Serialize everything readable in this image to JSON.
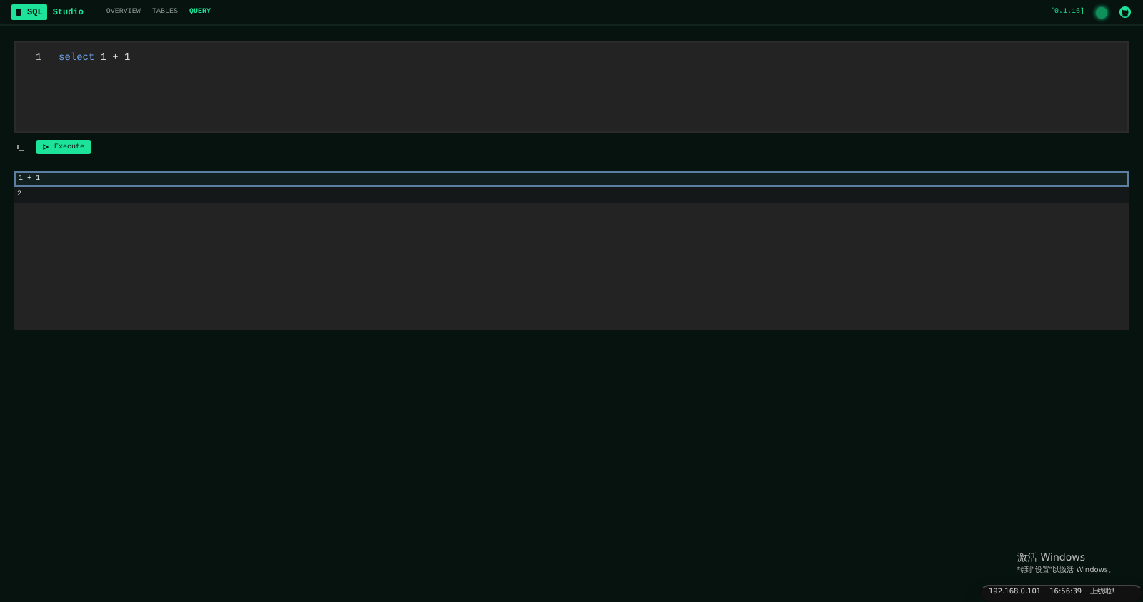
{
  "brand": {
    "part1": "SQL",
    "part2": "Studio"
  },
  "nav": [
    {
      "label": "OVERVIEW",
      "selected": false
    },
    {
      "label": "TABLES",
      "selected": false
    },
    {
      "label": "QUERY",
      "selected": true
    }
  ],
  "version": "[0.1.16]",
  "editor": {
    "lines": [
      {
        "number": "1",
        "keyword": "select",
        "rest": "1 + 1"
      }
    ]
  },
  "execute_button": "Execute",
  "result": {
    "columns": [
      "1 + 1"
    ],
    "rows": [
      [
        "2"
      ]
    ]
  },
  "watermark": {
    "title": "激活 Windows",
    "subtitle": "转到\"设置\"以激活 Windows。"
  },
  "toast": {
    "ip": "192.168.0.101",
    "time": "16:56:39",
    "message": "上线啦!"
  }
}
